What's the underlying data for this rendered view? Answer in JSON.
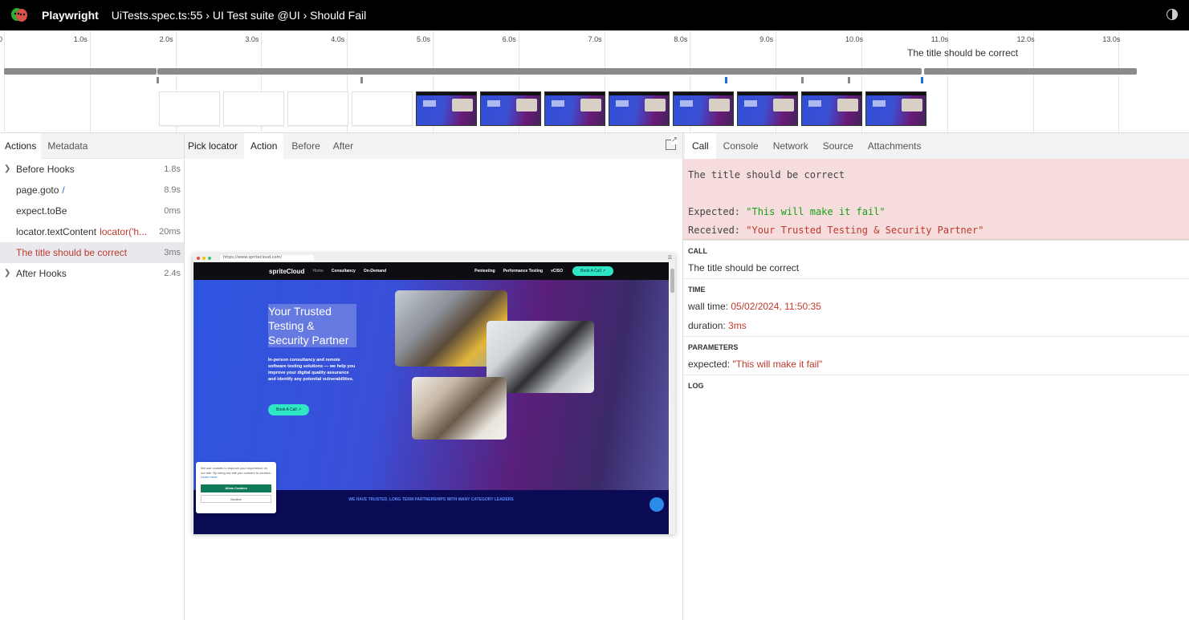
{
  "header": {
    "brand": "Playwright",
    "title": "UiTests.spec.ts:55 › UI Test suite @UI › Should Fail"
  },
  "timeline": {
    "ticks": [
      "0",
      "1.0s",
      "2.0s",
      "3.0s",
      "4.0s",
      "5.0s",
      "6.0s",
      "7.0s",
      "8.0s",
      "9.0s",
      "10.0s",
      "11.0s",
      "12.0s",
      "13.0s"
    ],
    "tooltip": "The title should be correct"
  },
  "left": {
    "tabs": [
      "Actions",
      "Metadata"
    ],
    "actions": [
      {
        "name": "Before Hooks",
        "arg": "",
        "duration": "1.8s",
        "expandable": true
      },
      {
        "name": "page.goto",
        "arg": "/",
        "duration": "8.9s",
        "expandable": false
      },
      {
        "name": "expect.toBe",
        "arg": "",
        "duration": "0ms",
        "expandable": false
      },
      {
        "name": "locator.textContent",
        "arg": "locator('h...",
        "duration": "20ms",
        "expandable": false
      },
      {
        "name": "The title should be correct",
        "arg": "",
        "duration": "3ms",
        "expandable": false
      },
      {
        "name": "After Hooks",
        "arg": "",
        "duration": "2.4s",
        "expandable": true
      }
    ]
  },
  "middle": {
    "pick_locator": "Pick locator",
    "tabs": [
      "Action",
      "Before",
      "After"
    ],
    "snapshot": {
      "url": "https://www.spritecloud.com/",
      "logo": "spriteCloud",
      "nav": [
        "Home",
        "Consultancy",
        "On-Demand"
      ],
      "nav_right": [
        "Pentesting",
        "Performance Testing",
        "vCISO"
      ],
      "nav_button": "Book A Call ↗",
      "hero_title": "Your Trusted Testing & Security Partner",
      "hero_text": "In-person consultancy and remote software testing solutions — we help you improve your digital quality assurance and identify any potential vulnerabilities.",
      "hero_button": "Book A Call ↗",
      "partners_text": "WE HAVE TRUSTED, LONG TERM PARTNERSHIPS WITH MANY CATEGORY LEADERS",
      "cookie_text": "We use cookies to improve your experience on our site. By using our site you consent to cookies.",
      "cookie_learn": "Learn more",
      "cookie_allow": "Allow Cookies",
      "cookie_decline": "Decline"
    }
  },
  "right": {
    "tabs": [
      "Call",
      "Console",
      "Network",
      "Source",
      "Attachments"
    ],
    "error": {
      "message": "The title should be correct",
      "expected_label": "Expected: ",
      "expected_value": "\"This will make it fail\"",
      "received_label": "Received: ",
      "received_value": "\"Your Trusted Testing & Security Partner\""
    },
    "call_header": "CALL",
    "call_value": "The title should be correct",
    "time_header": "TIME",
    "wall_label": "wall time: ",
    "wall_value": "05/02/2024, 11:50:35",
    "duration_label": "duration: ",
    "duration_value": "3ms",
    "params_header": "PARAMETERS",
    "param_label": "expected: ",
    "param_value": "\"This will make it fail\"",
    "log_header": "LOG"
  }
}
